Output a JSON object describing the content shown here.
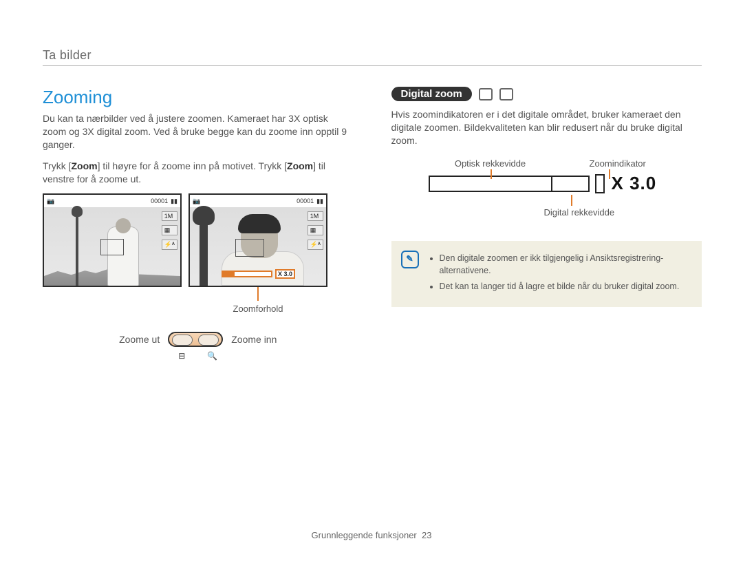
{
  "page_header": "Ta bilder",
  "left": {
    "title": "Zooming",
    "p1": "Du kan ta nærbilder ved å justere zoomen. Kameraet har 3X optisk zoom og 3X digital zoom. Ved å bruke begge kan du zoome inn opptil 9 ganger.",
    "p2_pre": "Trykk [",
    "p2_zoom": "Zoom",
    "p2_mid": "] til høyre for å zoome inn på motivet. Trykk [",
    "p2_zoom2": "Zoom",
    "p2_post": "] til venstre for å zoome ut.",
    "counter": "00001",
    "zoom_bar_label": "X 3.0",
    "caption": "Zoomforhold",
    "zoom_out": "Zoome ut",
    "zoom_in": "Zoome inn",
    "minus_icon": "⊟",
    "plus_icon": "🔍"
  },
  "right": {
    "pill": "Digital zoom",
    "p1": "Hvis zoomindikatoren er i det digitale området, bruker kameraet den digitale zoomen. Bildekvaliteten kan blir redusert når du bruke digital zoom.",
    "label_optical": "Optisk rekkevidde",
    "label_indicator": "Zoomindikator",
    "label_digital": "Digital rekkevidde",
    "zoom_value": "X 3.0",
    "notes": [
      "Den digitale zoomen er ikk tilgjengelig i Ansiktsregistrering-alternativene.",
      "Det kan ta langer tid å lagre et bilde når du bruker digital zoom."
    ],
    "note_glyph": "✎"
  },
  "footer": {
    "section": "Grunnleggende funksjoner",
    "page": "23"
  }
}
